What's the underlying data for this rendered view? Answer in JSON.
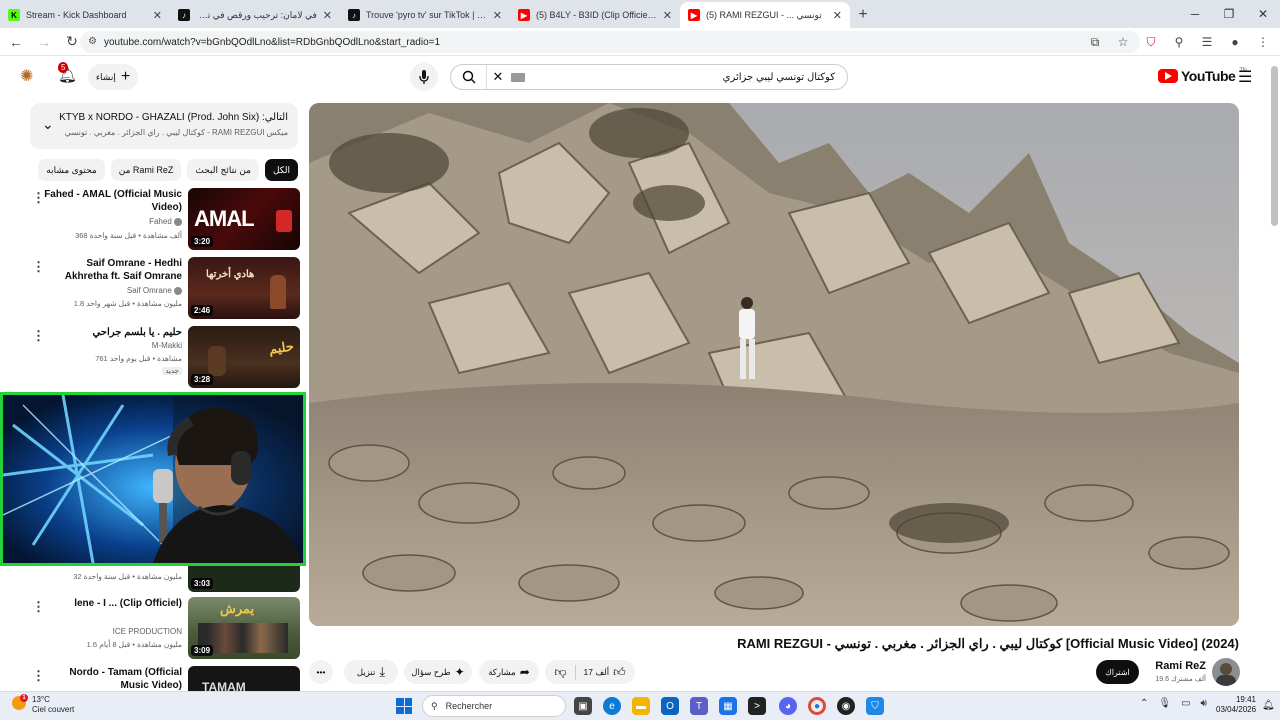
{
  "browser": {
    "tabs": [
      {
        "title": "Stream - Kick Dashboard",
        "favicon": "kick-icon",
        "color": "#53fc18"
      },
      {
        "title": "في لامان: ترحيب ورقص في تون...",
        "favicon": "tiktok-icon",
        "color": "#111111"
      },
      {
        "title": "Trouve 'pyro tv' sur TikTok | Rec",
        "favicon": "tiktok-icon",
        "color": "#111111"
      },
      {
        "title": "(5) B4LY - B3ID (Clip Officiel) - Y",
        "favicon": "youtube-icon",
        "color": "#ff0000"
      },
      {
        "title": "(5) RAMI REZGUI - ... تونسي",
        "favicon": "youtube-icon",
        "color": "#ff0000"
      }
    ],
    "url": "youtube.com/watch?v=bGnbQOdlLno&list=RDbGnbQOdlLno&start_radio=1"
  },
  "masthead": {
    "notif_count": "5",
    "create_label": "إنشاء",
    "search_query": "كوكتال تونسي ليبي جزائري",
    "logo_text": "YouTube",
    "logo_region": "TN"
  },
  "up_next": {
    "label": "التالي:",
    "title": "KTYB x NORDO - GHAZALI (Prod. John Six)",
    "subtitle": "ميكس RAMI REZGUI - كوكتال ليبي . راي الجزائر . مغربي . تونسي [Video"
  },
  "chips": [
    "الكل",
    "من نتائج البحث",
    "من Rami ReZ",
    "محتوى مشابه"
  ],
  "related": [
    {
      "title": "Fahed - AMAL (Official Music Video)",
      "channel": "Fahed",
      "meta": "368 ألف مشاهدة • قبل سنة واحدة",
      "duration": "3:20",
      "thumb_text": "AMAL"
    },
    {
      "title": "Saif Omrane - Hedhi Akhretha ft. Saif Omrane",
      "channel": "Saif Omrane",
      "meta": "1.8 مليون مشاهدة • قبل شهر واحد",
      "duration": "2:46",
      "thumb_text": "هادي أخرتها"
    },
    {
      "title": "حليم . يا بلسم جراحي",
      "channel": "M-Makki",
      "meta": "761 مشاهدة • قبل يوم واحد",
      "duration": "3:28",
      "badge": "جديد",
      "thumb_text": "حليم"
    },
    {
      "title": "",
      "channel": "",
      "meta": "32 مليون مشاهدة • قبل سنة واحدة",
      "duration": "3:03"
    },
    {
      "title": "lene - I ... (Clip Officiel)",
      "channel": "ICE PRODUCTION",
      "meta": "1.6 مليون مشاهدة • قبل 8 أيام",
      "duration": "3:09",
      "thumb_text": "يمرش"
    },
    {
      "title": "Nordo - Tamam (Official Music Video)",
      "channel": "",
      "meta": "",
      "duration": "",
      "thumb_text": "TAMAM"
    }
  ],
  "video": {
    "title": "RAMI REZGUI - كوكتال ليبي . راي الجزائر . مغربي . تونسي [Official Music Video] (2024)",
    "channel": "Rami ReZ",
    "subscribers": "19.6 ألف مشترك",
    "subscribe_label": "اشتراك",
    "likes": "17 ألف",
    "share_label": "مشاركة",
    "ask_label": "طرح سؤال",
    "download_label": "تنزيل"
  },
  "taskbar": {
    "temp": "13°C",
    "weather": "Ciel couvert",
    "search_placeholder": "Rechercher",
    "time": "19:41",
    "date": "03/04/2026"
  }
}
